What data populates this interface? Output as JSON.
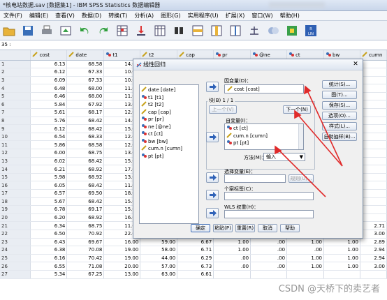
{
  "window": {
    "title": "*核电站数据.sav [数据集1] - IBM SPSS Statistics 数据编辑器"
  },
  "menu": [
    "文件(F)",
    "编辑(E)",
    "查看(V)",
    "数据(D)",
    "转换(T)",
    "分析(A)",
    "图形(G)",
    "实用程序(U)",
    "扩展(X)",
    "窗口(W)",
    "帮助(H)"
  ],
  "cell_ref": "35 :",
  "grid": {
    "columns": [
      "cost",
      "date",
      "t1",
      "t2",
      "cap",
      "pr",
      "@ne",
      "ct",
      "bw",
      "cumn"
    ],
    "rows": [
      [
        "1",
        "6.13",
        "68.58",
        "14.00",
        "",
        "",
        "",
        "",
        "",
        "",
        ""
      ],
      [
        "2",
        "6.12",
        "67.33",
        "10.00",
        "",
        "",
        "",
        "",
        "",
        "",
        ""
      ],
      [
        "3",
        "6.09",
        "67.33",
        "10.00",
        "",
        "",
        "",
        "",
        "",
        "",
        ""
      ],
      [
        "4",
        "6.48",
        "68.00",
        "11.00",
        "",
        "",
        "",
        "",
        "",
        "",
        ""
      ],
      [
        "5",
        "6.46",
        "68.00",
        "11.00",
        "",
        "",
        "",
        "",
        "",
        "",
        ""
      ],
      [
        "6",
        "5.84",
        "67.92",
        "13.00",
        "",
        "",
        "",
        "",
        "",
        "",
        ""
      ],
      [
        "7",
        "5.61",
        "68.17",
        "12.00",
        "",
        "",
        "",
        "",
        "",
        "",
        ""
      ],
      [
        "8",
        "5.76",
        "68.42",
        "14.00",
        "",
        "",
        "",
        "",
        "",
        "",
        ""
      ],
      [
        "9",
        "6.12",
        "68.42",
        "15.00",
        "",
        "",
        "",
        "",
        "",
        "",
        ""
      ],
      [
        "10",
        "6.54",
        "68.33",
        "12.00",
        "",
        "",
        "",
        "",
        "",
        "",
        ""
      ],
      [
        "11",
        "5.86",
        "68.58",
        "12.00",
        "",
        "",
        "",
        "",
        "",
        "",
        ""
      ],
      [
        "12",
        "6.00",
        "68.75",
        "13.00",
        "",
        "",
        "",
        "",
        "",
        "",
        ""
      ],
      [
        "13",
        "6.02",
        "68.42",
        "15.00",
        "",
        "",
        "",
        "",
        "",
        "",
        ""
      ],
      [
        "14",
        "6.21",
        "68.92",
        "17.00",
        "",
        "",
        "",
        "",
        "",
        "",
        ""
      ],
      [
        "15",
        "5.98",
        "68.92",
        "13.00",
        "",
        "",
        "",
        "",
        "",
        "",
        ""
      ],
      [
        "16",
        "6.05",
        "68.42",
        "11.00",
        "",
        "",
        "",
        "",
        "",
        "",
        ""
      ],
      [
        "17",
        "6.57",
        "69.50",
        "18.00",
        "",
        "",
        "",
        "",
        "",
        "",
        ""
      ],
      [
        "18",
        "5.67",
        "68.42",
        "15.00",
        "",
        "",
        "",
        "",
        "",
        "",
        ""
      ],
      [
        "19",
        "6.78",
        "69.17",
        "15.00",
        "",
        "",
        "",
        "",
        "",
        "",
        ""
      ],
      [
        "20",
        "6.20",
        "68.92",
        "16.00",
        "",
        "",
        "",
        "",
        "",
        "",
        ""
      ],
      [
        "21",
        "6.34",
        "68.75",
        "11.00",
        "70.00",
        "6.82",
        ".00",
        ".00",
        "1.00",
        "1.00",
        "2.71"
      ],
      [
        "22",
        "6.50",
        "70.92",
        "22.00",
        "57.00",
        "6.72",
        "1.00",
        ".00",
        ".00",
        "1.00",
        "3.00"
      ],
      [
        "23",
        "6.43",
        "69.67",
        "16.00",
        "59.00",
        "6.67",
        "1.00",
        ".00",
        "1.00",
        "1.00",
        "2.89"
      ],
      [
        "24",
        "6.38",
        "70.08",
        "19.00",
        "58.00",
        "6.71",
        "1.00",
        ".00",
        ".00",
        "1.00",
        "2.94"
      ],
      [
        "25",
        "6.16",
        "70.42",
        "19.00",
        "44.00",
        "6.29",
        ".00",
        ".00",
        "1.00",
        "1.00",
        "2.94"
      ],
      [
        "26",
        "6.55",
        "71.08",
        "20.00",
        "57.00",
        "6.73",
        ".00",
        ".00",
        "1.00",
        "1.00",
        "3.00"
      ],
      [
        "27",
        "5.34",
        "67.25",
        "13.00",
        "63.00",
        "6.61",
        "",
        "",
        "",
        "",
        ""
      ]
    ]
  },
  "dialog": {
    "title": "线性回归",
    "variables": [
      "date [date]",
      "t1 [t1]",
      "t2 [t2]",
      "cap [cap]",
      "pr [pr]",
      "ne [@ne]",
      "ct [ct]",
      "bw [bw]",
      "cum.n [cumn]",
      "pt [pt]"
    ],
    "dependent_label": "因变量(D)：",
    "dependent_value": "cost [cost]",
    "block_label": "块(B) 1 / 1",
    "prev_button": "上一个(V)",
    "next_button": "下一个(N)",
    "independent_label": "自变量(I)：",
    "independents": [
      "ct [ct]",
      "cum.n [cumn]",
      "pt [pt]"
    ],
    "method_label": "方法(M)：",
    "method_value": "输入",
    "selection_label": "选择变量(E)：",
    "rule_button": "规则(U)...",
    "case_label_label": "个案标签(C)：",
    "wls_label": "WLS 权重(H)：",
    "side_buttons": [
      "统计(S)...",
      "图(T)...",
      "保存(S)...",
      "选项(O)...",
      "样式(L)...",
      "自助抽样(B)..."
    ],
    "bottom_buttons": [
      "确定",
      "粘贴(P)",
      "重置(R)",
      "取消",
      "帮助"
    ]
  },
  "watermark": "CSDN @天桥下的卖艺者",
  "colors": {
    "annotation_arrow": "#e02a2a",
    "dialog_bg": "#f0f0f0",
    "grid_header": "#e9edf3"
  }
}
